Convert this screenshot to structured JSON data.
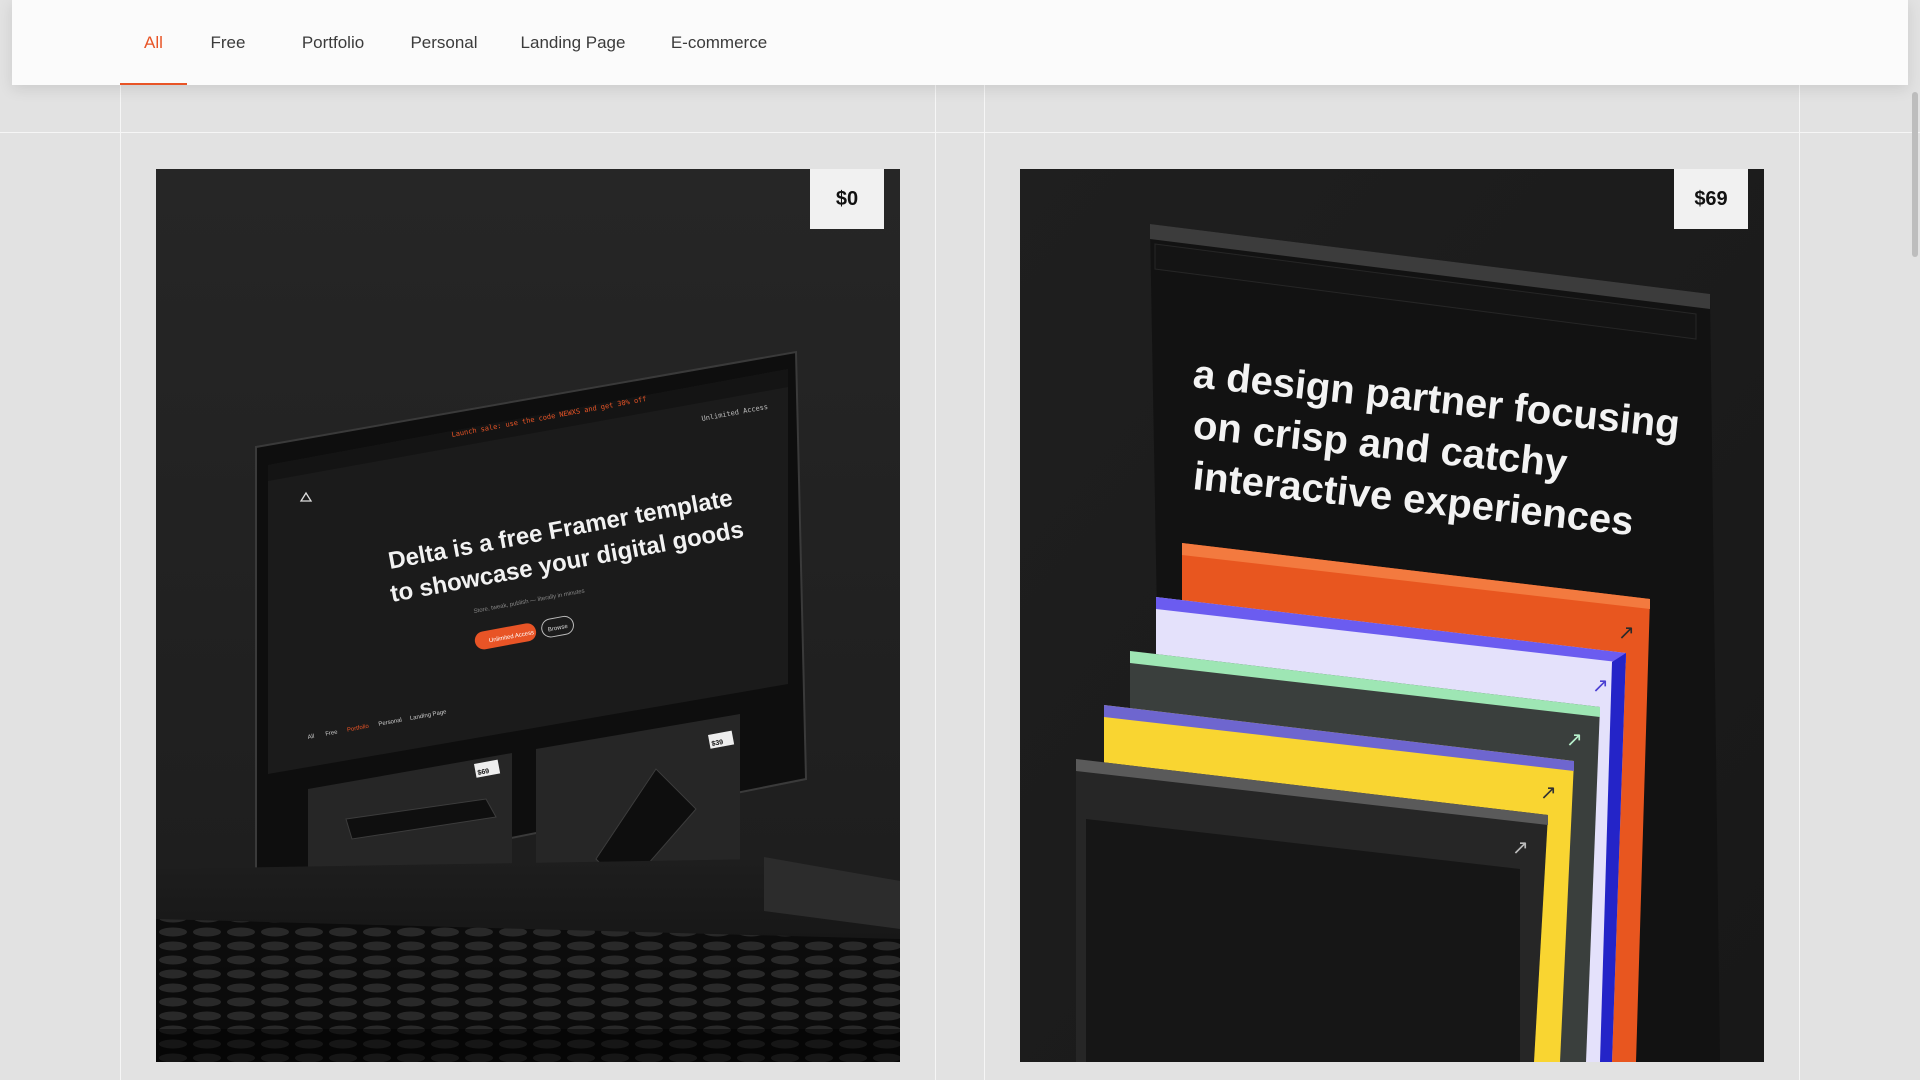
{
  "tabs": [
    {
      "label": "All",
      "active": true
    },
    {
      "label": "Free",
      "active": false
    },
    {
      "label": "Portfolio",
      "active": false
    },
    {
      "label": "Personal",
      "active": false
    },
    {
      "label": "Landing Page",
      "active": false
    },
    {
      "label": "E-commerce",
      "active": false
    }
  ],
  "cards": [
    {
      "price": "$0",
      "image": {
        "headline_1": "Delta is a free Framer template",
        "headline_2": "to showcase your digital goods",
        "sub": "Store, tweak, publish — literally in minutes",
        "banner": "Launch sale: use the code NEWXS and get 30% off",
        "top_right": "Unlimited Access",
        "primary_btn": "Unlimited Access",
        "secondary_btn": "Browse",
        "mini_tabs": [
          "All",
          "Free",
          "Portfolio",
          "Personal",
          "Landing Page"
        ],
        "mini_price_1": "$69",
        "mini_price_2": "$39"
      }
    },
    {
      "price": "$69",
      "image": {
        "line_1": "a design partner focusing",
        "line_2": "on crisp and catchy",
        "line_3": "interactive experiences"
      }
    }
  ],
  "colors": {
    "accent": "#e85426",
    "background": "#e2e2e2",
    "card": "#252525"
  }
}
